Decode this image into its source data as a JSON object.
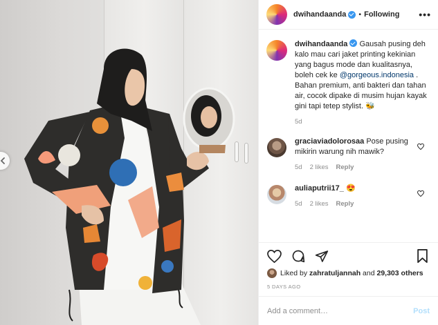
{
  "header": {
    "username": "dwihandaanda",
    "separator": "•",
    "follow_label": "Following",
    "more_label": "•••"
  },
  "caption": {
    "username": "dwihandaanda",
    "text_before_mention": "Gausah pusing deh kalo mau cari jaket printing kekinian yang bagus mode dan kualitasnya, boleh cek ke ",
    "mention": "@gorgeous.indonesia",
    "text_after_mention": " . Bahan premium, anti bakteri dan tahan air, cocok dipake di musim hujan kayak gini tapi tetep stylist. 🐝",
    "age": "5d"
  },
  "comments": [
    {
      "username": "graciaviadolorosaa",
      "text": "Pose pusing mikirin warung nih mawik?",
      "age": "5d",
      "likes": "2 likes",
      "reply_label": "Reply"
    },
    {
      "username": "auliaputrii17_",
      "text": "😍",
      "age": "5d",
      "likes": "2 likes",
      "reply_label": "Reply"
    }
  ],
  "actions": {
    "like_icon": "heart-icon",
    "comment_icon": "comment-icon",
    "share_icon": "share-icon",
    "save_icon": "bookmark-icon"
  },
  "likes": {
    "prefix": "Liked by ",
    "user": "zahratuljannah",
    "middle": " and ",
    "others": "29,303 others"
  },
  "date": "5 DAYS AGO",
  "add_comment": {
    "placeholder": "Add a comment…",
    "post_label": "Post"
  },
  "colors": {
    "link": "#00376b",
    "verified": "#3897f0",
    "post_button_disabled": "#b2dffc",
    "muted": "#8e8e8e"
  }
}
